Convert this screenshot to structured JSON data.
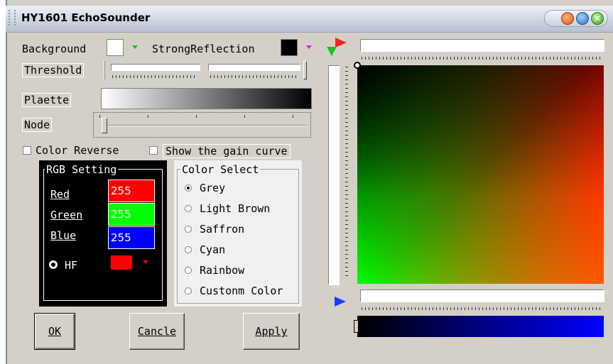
{
  "window": {
    "title": "HY1601 EchoSounder"
  },
  "labels": {
    "background": "Background",
    "strong_reflection": "StrongReflection",
    "threshold": "Threshold",
    "palette": "Plaette",
    "node": "Node"
  },
  "checkboxes": {
    "color_reverse": "Color Reverse",
    "show_gain_curve": "Show the gain curve"
  },
  "rgb_setting": {
    "title": "RGB Setting",
    "red_label": "Red",
    "green_label": "Green",
    "blue_label": "Blue",
    "red_value": "255",
    "green_value": "255",
    "blue_value": "255",
    "hf_label": "HF"
  },
  "color_select": {
    "title": "Color Select",
    "options": [
      "Grey",
      "Light Brown",
      "Saffron",
      "Cyan",
      "Rainbow",
      "Custonm Color"
    ],
    "selected": "Grey"
  },
  "buttons": {
    "ok": "OK",
    "cancel": "Cancle",
    "apply": "Apply"
  },
  "colors": {
    "background_swatch": "#ffffff",
    "strong_reflection_swatch": "#000000",
    "red_field": "#ff0000",
    "green_field": "#00ff00",
    "blue_field": "#0000ff",
    "hf_swatch": "#ff0000",
    "window_face": "#d4d0c8"
  },
  "icons": [
    "title-grip-icon",
    "minimize-icon",
    "restore-icon",
    "close-icon",
    "dropdown-arrow-icon",
    "red-pointer-icon",
    "green-pointer-icon",
    "blue-pointer-icon",
    "crosshair-icon"
  ]
}
